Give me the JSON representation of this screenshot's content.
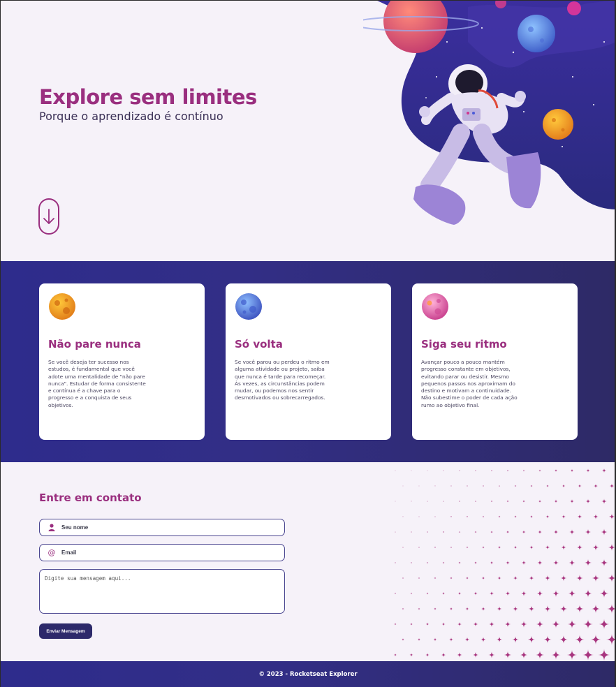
{
  "hero": {
    "title": "Explore sem limites",
    "subtitle": "Porque o aprendizado é contínuo",
    "scroll_icon": "arrow-down-icon",
    "illustration": "astronaut-in-space",
    "title_color": "#9A2F7F"
  },
  "cards": [
    {
      "title": "Não pare nunca",
      "text": "Se você deseja ter sucesso nos estudos, é fundamental que você adote uma mentalidade de \"não pare nunca\". Estudar de forma consistente e contínua é a chave para o progresso e a conquista de seus objetivos.",
      "icon": "orange-planet-icon"
    },
    {
      "title": "Só volta",
      "text": "Se você parou ou perdeu o ritmo em alguma atividade ou projeto, saiba que nunca é tarde para recomeçar. Às vezes, as circunstâncias podem mudar, ou podemos nos sentir desmotivados ou sobrecarregados.",
      "icon": "blue-planet-icon"
    },
    {
      "title": "Siga seu ritmo",
      "text": "Avançar pouco a pouco mantém progresso constante em objetivos, evitando parar ou desistir. Mesmo pequenos passos nos aproximam do destino e motivam a continuidade. Não subestime o poder de cada ação rumo ao objetivo final.",
      "icon": "pink-planet-icon"
    }
  ],
  "contact": {
    "title": "Entre em contato",
    "name_placeholder": "Seu nome",
    "email_placeholder": "Email",
    "message_placeholder": "Digite sua mensagem aqui...",
    "submit_label": "Enviar Mensagem"
  },
  "footer": {
    "text": "© 2023 - Rocketseat Explorer"
  },
  "colors": {
    "accent": "#9A2F7F",
    "dark_blue": "#2E2C8C",
    "background": "#F6F2F9"
  }
}
